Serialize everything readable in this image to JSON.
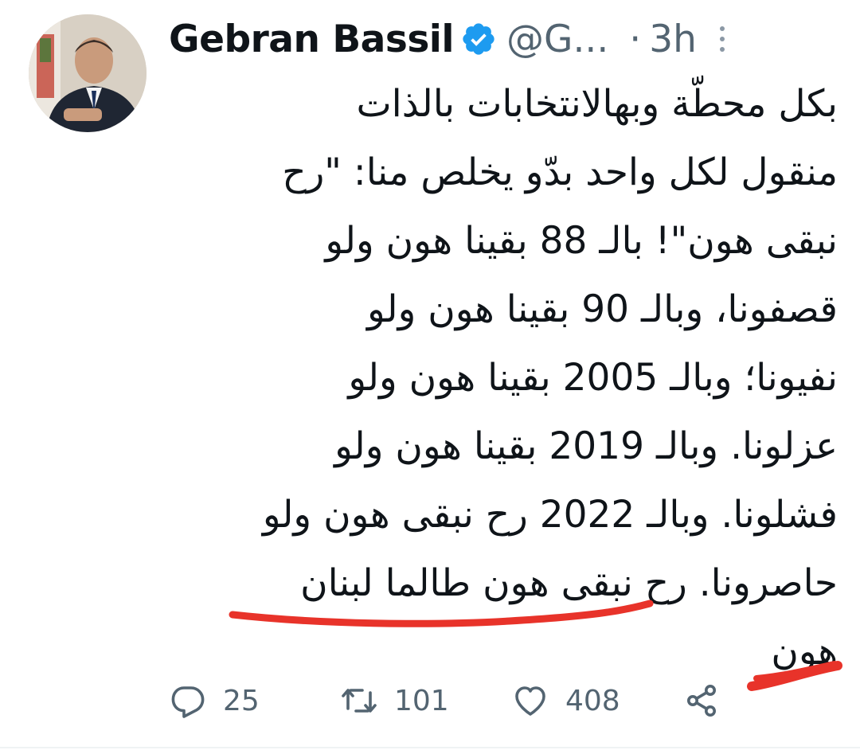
{
  "author": {
    "display_name": "Gebran Bassil",
    "handle": "@G...",
    "separator": "·",
    "timestamp": "3h",
    "verified": true
  },
  "tweet": {
    "lines": [
      "بكل محطّة وبهالانتخابات بالذات",
      "منقول لكل واحد بدّو يخلص منا: \"رح",
      "نبقى هون\"! بالـ 88 بقينا هون ولو",
      "قصفونا، وبالـ 90 بقينا هون ولو",
      "نفيونا؛ وبالـ 2005 بقينا هون ولو",
      "عزلونا. وبالـ 2019 بقينا هون ولو",
      "فشلونا. وبالـ 2022 رح نبقى هون ولو",
      "حاصرونا. رح نبقى هون طالما لبنان",
      "هون"
    ]
  },
  "actions": {
    "reply_count": "25",
    "retweet_count": "101",
    "like_count": "408"
  },
  "icons": {
    "verified": "verified-badge-icon",
    "more": "more-vertical-icon",
    "reply": "reply-icon",
    "retweet": "retweet-icon",
    "like": "heart-icon",
    "share": "share-icon"
  },
  "colors": {
    "text": "#0f1419",
    "secondary": "#536471",
    "verified": "#1d9bf0",
    "annotation": "#e8332a"
  }
}
